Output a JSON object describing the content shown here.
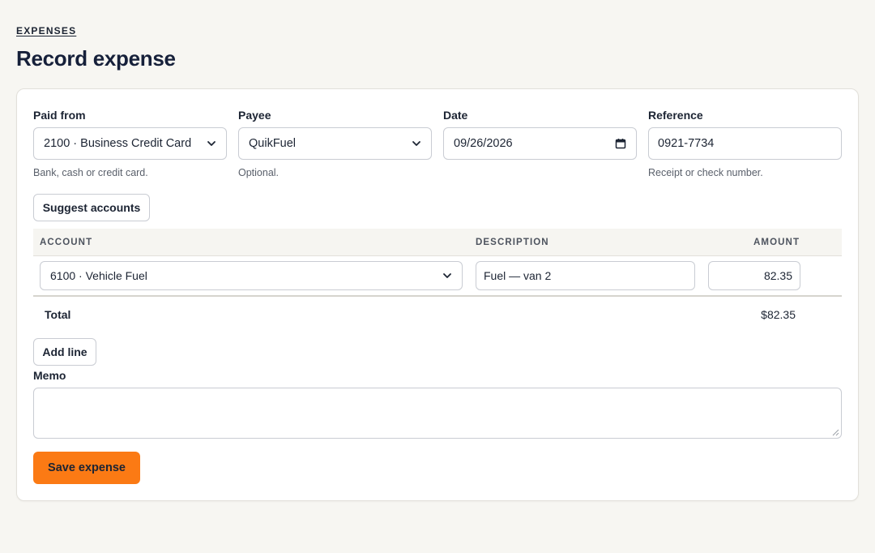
{
  "breadcrumb": "EXPENSES",
  "page_title": "Record expense",
  "form": {
    "paid_from": {
      "label": "Paid from",
      "value": "2100 · Business Credit Card",
      "hint": "Bank, cash or credit card."
    },
    "payee": {
      "label": "Payee",
      "value": "QuikFuel",
      "hint": "Optional."
    },
    "date": {
      "label": "Date",
      "value": "09/26/2026"
    },
    "reference": {
      "label": "Reference",
      "value": "0921-7734",
      "hint": "Receipt or check number."
    }
  },
  "suggest_button": "Suggest accounts",
  "table": {
    "headers": {
      "account": "ACCOUNT",
      "description": "DESCRIPTION",
      "amount": "AMOUNT"
    },
    "rows": [
      {
        "account": "6100 · Vehicle Fuel",
        "description": "Fuel — van 2",
        "amount": "82.35"
      }
    ],
    "total_label": "Total",
    "total_value": "$82.35"
  },
  "add_line_button": "Add line",
  "memo": {
    "label": "Memo",
    "value": ""
  },
  "save_button": "Save expense",
  "colors": {
    "accent": "#fb7a14",
    "background": "#f7f6f2",
    "text": "#1c2433"
  },
  "icons": {
    "select": "chevron-down-icon",
    "date": "calendar-icon"
  }
}
